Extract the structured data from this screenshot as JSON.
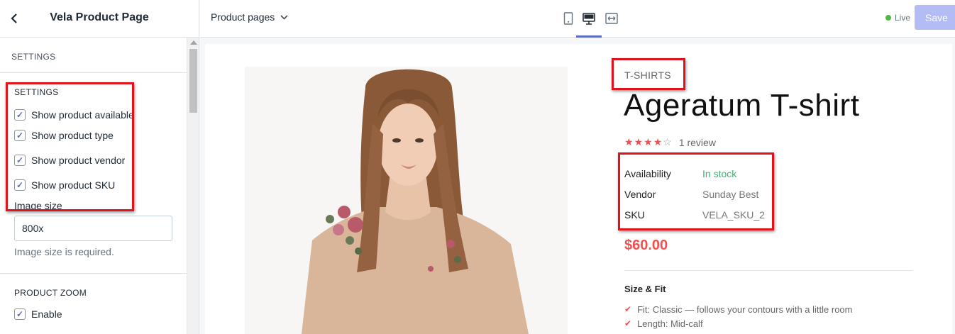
{
  "sidebar": {
    "title": "Vela Product Page",
    "section_title": "SETTINGS",
    "settings_label": "SETTINGS",
    "checkboxes": [
      {
        "label": "Show product available",
        "checked": true
      },
      {
        "label": "Show product type",
        "checked": true
      },
      {
        "label": "Show product vendor",
        "checked": true
      },
      {
        "label": "Show product SKU",
        "checked": true
      }
    ],
    "image_size_label": "Image size",
    "image_size_value": "800x",
    "image_size_help": "Image size is required.",
    "zoom_label": "PRODUCT ZOOM",
    "zoom_enable_label": "Enable"
  },
  "topbar": {
    "page_select": "Product pages",
    "live_label": "Live",
    "save_label": "Save",
    "devices": [
      "mobile-icon",
      "desktop-icon",
      "fullwidth-icon"
    ],
    "active_device": "desktop-icon"
  },
  "product": {
    "type": "T-SHIRTS",
    "title": "Ageratum T-shirt",
    "rating": 4,
    "rating_max": 5,
    "review_text": "1 review",
    "meta": [
      {
        "key": "Availability",
        "value": "In stock"
      },
      {
        "key": "Vendor",
        "value": "Sunday Best"
      },
      {
        "key": "SKU",
        "value": "VELA_SKU_2"
      }
    ],
    "price": "$60.00",
    "size_fit_title": "Size & Fit",
    "size_fit_items": [
      "Fit: Classic — follows your contours with a little room",
      "Length: Mid-calf"
    ]
  },
  "colors": {
    "accent": "#5c6ac4",
    "save_disabled": "#b3bcf5",
    "price": "#f44f4f",
    "in_stock": "#3cb371",
    "highlight_box": "#e0121b"
  }
}
